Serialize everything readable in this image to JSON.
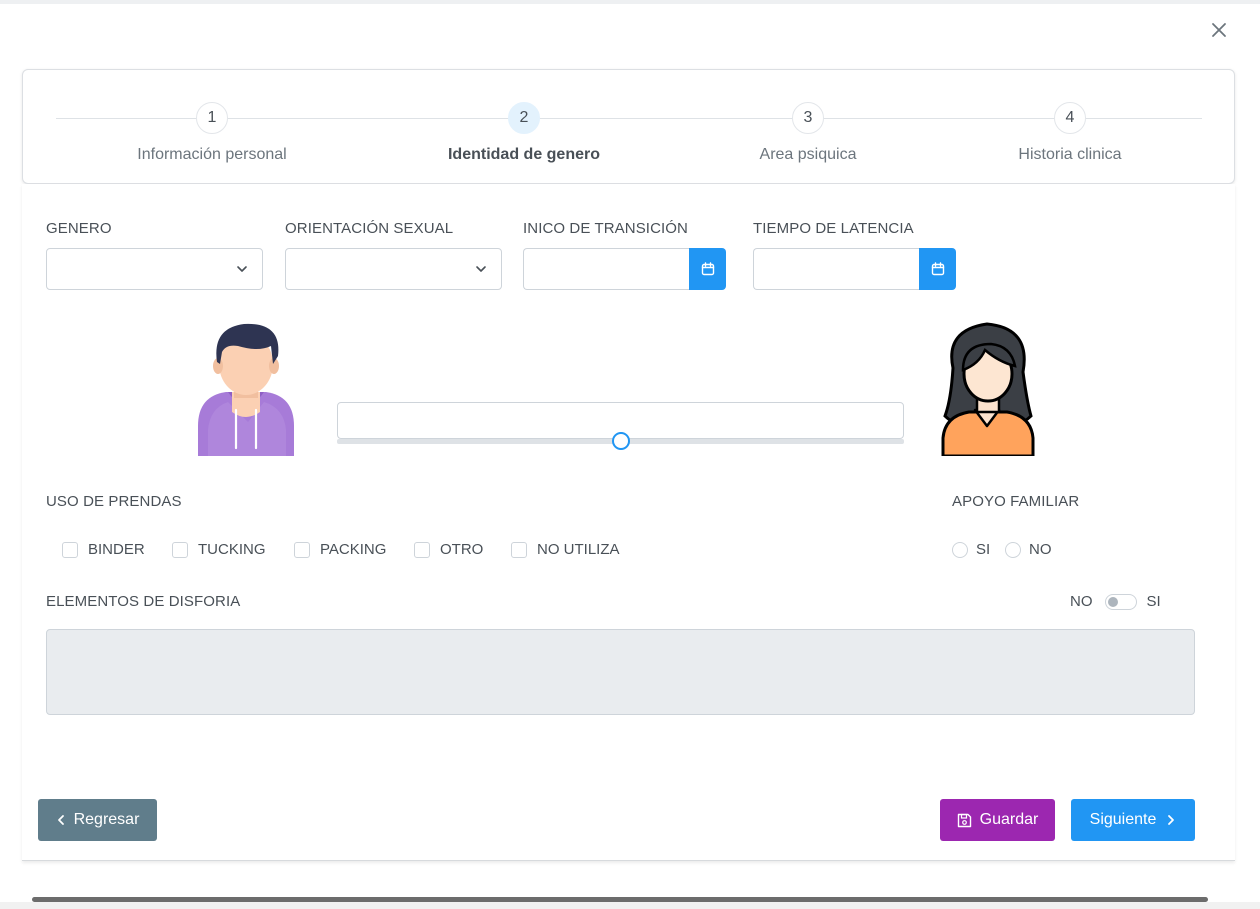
{
  "dialog": {
    "close_icon": "close-icon"
  },
  "stepper": {
    "steps": [
      {
        "number": "1",
        "label": "Información personal",
        "active": false
      },
      {
        "number": "2",
        "label": "Identidad de genero",
        "active": true
      },
      {
        "number": "3",
        "label": "Area psiquica",
        "active": false
      },
      {
        "number": "4",
        "label": "Historia clinica",
        "active": false
      }
    ]
  },
  "form": {
    "genero": {
      "label": "GENERO",
      "value": ""
    },
    "orientacion": {
      "label": "ORIENTACIÓN SEXUAL",
      "value": ""
    },
    "inicio_transicion": {
      "label": "INICO DE TRANSICIÓN",
      "value": ""
    },
    "tiempo_latencia": {
      "label": "TIEMPO DE LATENCIA",
      "value": ""
    },
    "slider": {
      "value": 0.5,
      "input_value": ""
    },
    "uso_prendas": {
      "label": "USO DE PRENDAS",
      "options": [
        "BINDER",
        "TUCKING",
        "PACKING",
        "OTRO",
        "NO UTILIZA"
      ]
    },
    "apoyo_familiar": {
      "label": "APOYO FAMILIAR",
      "options": [
        "SI",
        "NO"
      ]
    },
    "disforia": {
      "label": "ELEMENTOS DE DISFORIA",
      "toggle_off_label": "NO",
      "toggle_on_label": "SI",
      "toggle_on": false,
      "value": ""
    }
  },
  "actions": {
    "back_label": "Regresar",
    "save_label": "Guardar",
    "next_label": "Siguiente"
  },
  "colors": {
    "primary": "#2196f3",
    "save": "#9c27b0",
    "back": "#607d8b",
    "disabled_bg": "#e9ecef"
  }
}
